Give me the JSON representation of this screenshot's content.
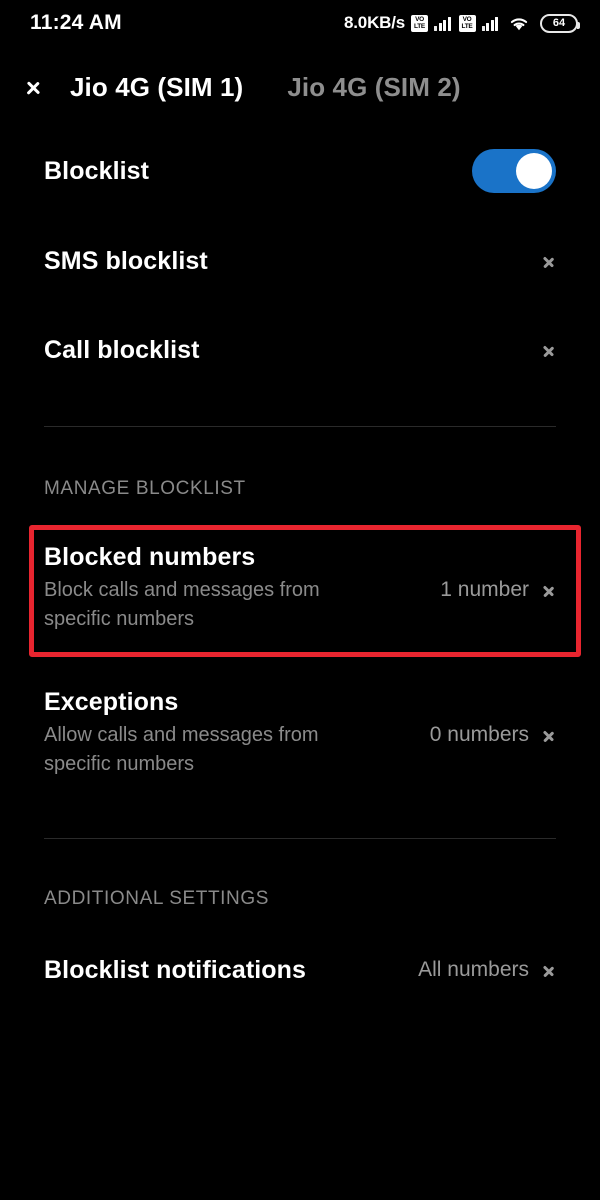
{
  "status_bar": {
    "time": "11:24 AM",
    "net_speed": "8.0KB/s",
    "volte_label_top": "VO",
    "volte_label_bottom": "LTE",
    "battery_level": "64"
  },
  "header": {
    "back_icon": "chevron-left-icon",
    "active_tab": "Jio 4G (SIM 1)",
    "inactive_tab": "Jio 4G (SIM 2)"
  },
  "rows": {
    "blocklist": {
      "title": "Blocklist",
      "toggle_on": true
    },
    "sms_blocklist": {
      "title": "SMS blocklist"
    },
    "call_blocklist": {
      "title": "Call blocklist"
    }
  },
  "sections": {
    "manage": "MANAGE BLOCKLIST",
    "additional": "ADDITIONAL SETTINGS"
  },
  "manage_items": {
    "blocked_numbers": {
      "title": "Blocked numbers",
      "subtitle": "Block calls and messages from specific numbers",
      "value": "1 number"
    },
    "exceptions": {
      "title": "Exceptions",
      "subtitle": "Allow calls and messages from specific numbers",
      "value": "0 numbers"
    }
  },
  "additional_items": {
    "blocklist_notifications": {
      "title": "Blocklist notifications",
      "value": "All numbers"
    }
  },
  "colors": {
    "accent_toggle": "#1a73c8",
    "highlight": "#e8252f",
    "background": "#000000",
    "primary_text": "#ffffff",
    "secondary_text": "#8a8a8a"
  }
}
